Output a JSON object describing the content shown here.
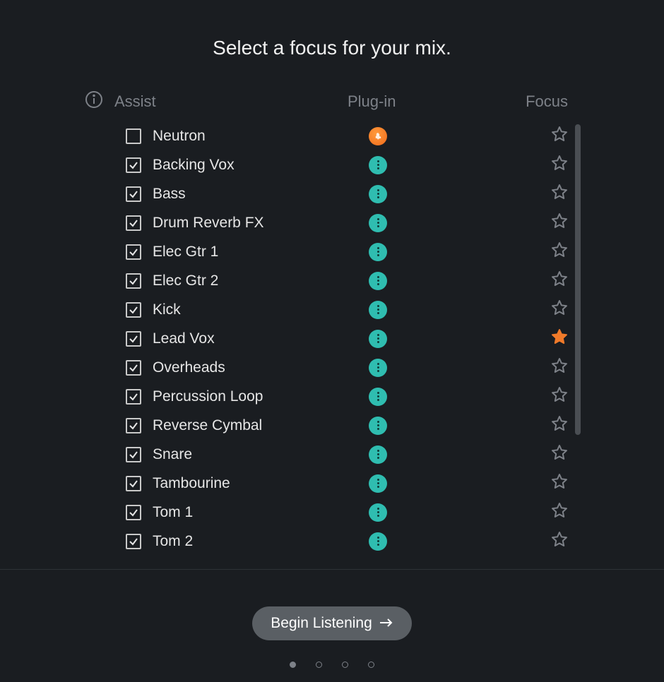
{
  "title": "Select a focus for your mix.",
  "columns": {
    "assist": "Assist",
    "plugin": "Plug-in",
    "focus": "Focus"
  },
  "tracks": [
    {
      "name": "Neutron",
      "checked": false,
      "plugin": "orange",
      "focus": false
    },
    {
      "name": "Backing Vox",
      "checked": true,
      "plugin": "teal",
      "focus": false
    },
    {
      "name": "Bass",
      "checked": true,
      "plugin": "teal",
      "focus": false
    },
    {
      "name": "Drum Reverb FX",
      "checked": true,
      "plugin": "teal",
      "focus": false
    },
    {
      "name": "Elec Gtr 1",
      "checked": true,
      "plugin": "teal",
      "focus": false
    },
    {
      "name": "Elec Gtr 2",
      "checked": true,
      "plugin": "teal",
      "focus": false
    },
    {
      "name": "Kick",
      "checked": true,
      "plugin": "teal",
      "focus": false
    },
    {
      "name": "Lead Vox",
      "checked": true,
      "plugin": "teal",
      "focus": true
    },
    {
      "name": "Overheads",
      "checked": true,
      "plugin": "teal",
      "focus": false
    },
    {
      "name": "Percussion Loop",
      "checked": true,
      "plugin": "teal",
      "focus": false
    },
    {
      "name": "Reverse Cymbal",
      "checked": true,
      "plugin": "teal",
      "focus": false
    },
    {
      "name": "Snare",
      "checked": true,
      "plugin": "teal",
      "focus": false
    },
    {
      "name": "Tambourine",
      "checked": true,
      "plugin": "teal",
      "focus": false
    },
    {
      "name": "Tom 1",
      "checked": true,
      "plugin": "teal",
      "focus": false
    },
    {
      "name": "Tom 2",
      "checked": true,
      "plugin": "teal",
      "focus": false
    }
  ],
  "footer": {
    "begin_label": "Begin Listening",
    "page_count": 4,
    "active_page": 0
  },
  "colors": {
    "teal": "#2fbdb0",
    "orange": "#f07a2a",
    "star_filled": "#f07a2a",
    "star_empty": "#7d8188"
  }
}
